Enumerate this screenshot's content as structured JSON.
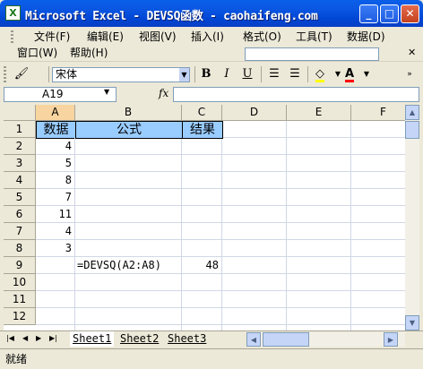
{
  "window": {
    "title": "Microsoft Excel - DEVSQ函数 - caohaifeng.com",
    "icon": "X"
  },
  "menu": {
    "items": [
      "文件(F)",
      "编辑(E)",
      "视图(V)",
      "插入(I)",
      "格式(O)",
      "工具(T)",
      "数据(D)"
    ],
    "items2": [
      "窗口(W)",
      "帮助(H)"
    ],
    "close": "✕"
  },
  "toolbar": {
    "font": "宋体",
    "bold": "B",
    "italic": "I",
    "underline": "U",
    "font_color_letter": "A"
  },
  "formula": {
    "name_box": "A19",
    "fx": "fx",
    "value": ""
  },
  "columns": [
    "A",
    "B",
    "C",
    "D",
    "E",
    "F"
  ],
  "rows": [
    "1",
    "2",
    "3",
    "4",
    "5",
    "6",
    "7",
    "8",
    "9",
    "10",
    "11",
    "12"
  ],
  "cells": {
    "a1": "数据",
    "b1": "公式",
    "c1": "结果",
    "a2": "4",
    "a3": "5",
    "a4": "8",
    "a5": "7",
    "a6": "11",
    "a7": "4",
    "a8": "3",
    "b9": "=DEVSQ(A2:A8)",
    "c9": "48"
  },
  "sheets": [
    "Sheet1",
    "Sheet2",
    "Sheet3"
  ],
  "status": "就绪"
}
